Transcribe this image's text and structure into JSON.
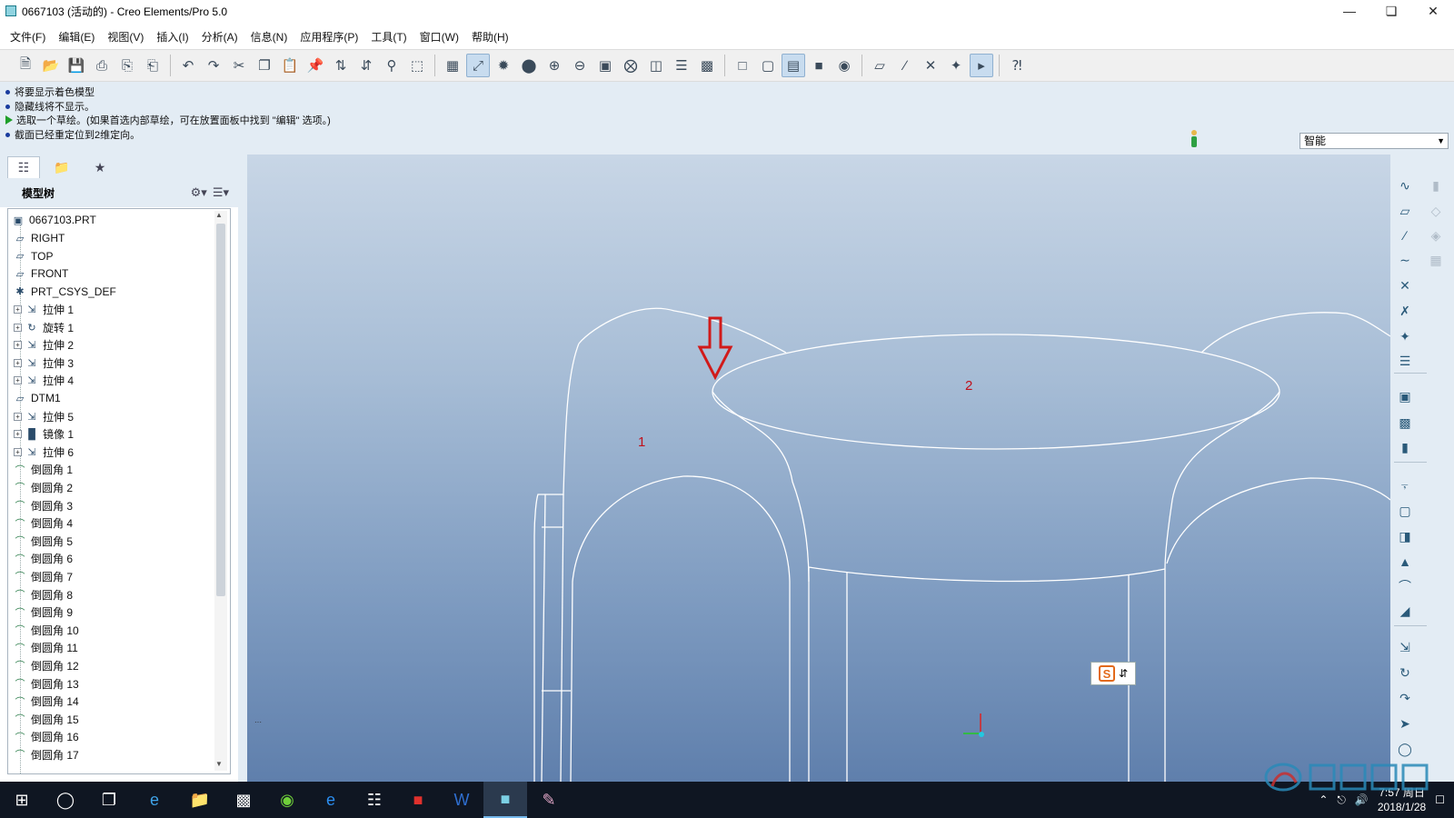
{
  "window": {
    "title": "0667103 (活动的) - Creo Elements/Pro 5.0",
    "controls": [
      "minimize-icon",
      "restore-icon",
      "close-icon"
    ]
  },
  "menubar": {
    "items": [
      "文件(F)",
      "编辑(E)",
      "视图(V)",
      "插入(I)",
      "分析(A)",
      "信息(N)",
      "应用程序(P)",
      "工具(T)",
      "窗口(W)",
      "帮助(H)"
    ]
  },
  "toolbar": {
    "icons": [
      "new-file-icon",
      "open-folder-icon",
      "save-icon",
      "print-icon",
      "print-preview-icon",
      "print-quick-icon",
      "undo-icon",
      "redo-icon",
      "cut-icon",
      "copy-icon",
      "paste-icon",
      "paste-special-icon",
      "regenerate-icon",
      "regen-manager-icon",
      "find-icon",
      "select-box-icon",
      "datum-display-icon",
      "axis-display-icon",
      "point-display-icon",
      "shading-icon",
      "zoom-in-icon",
      "zoom-out-icon",
      "refit-icon",
      "orient-icon",
      "saved-views-icon",
      "layers-icon",
      "view-manager-icon",
      "wireframe-icon",
      "hidden-line-icon",
      "no-hidden-icon",
      "shaded-icon",
      "enhanced-realism-icon",
      "datum-plane-display-icon",
      "datum-axis-display-icon",
      "point-display-toggle-icon",
      "csys-display-icon",
      "annotation-display-icon",
      "context-help-icon"
    ]
  },
  "messages": [
    {
      "type": "info",
      "text": "将要显示着色模型"
    },
    {
      "type": "info",
      "text": "隐藏线将不显示。"
    },
    {
      "type": "prompt",
      "text": "选取一个草绘。(如果首选内部草绘，可在放置面板中找到 \"编辑\" 选项。)"
    },
    {
      "type": "info",
      "text": "截面已经重定位到2维定向。"
    }
  ],
  "filter": {
    "value": "智能"
  },
  "navigator": {
    "tabs": [
      "model-tree-tab-icon",
      "folder-browser-tab-icon",
      "favorites-tab-icon"
    ],
    "header": "模型树"
  },
  "tree": {
    "root": "0667103.PRT",
    "items": [
      {
        "label": "RIGHT",
        "icon": "datum-plane-icon",
        "expandable": false
      },
      {
        "label": "TOP",
        "icon": "datum-plane-icon",
        "expandable": false
      },
      {
        "label": "FRONT",
        "icon": "datum-plane-icon",
        "expandable": false
      },
      {
        "label": "PRT_CSYS_DEF",
        "icon": "csys-icon",
        "expandable": false
      },
      {
        "label": "拉伸 1",
        "icon": "extrude-icon",
        "expandable": true
      },
      {
        "label": "旋转 1",
        "icon": "revolve-icon",
        "expandable": true
      },
      {
        "label": "拉伸 2",
        "icon": "extrude-icon",
        "expandable": true
      },
      {
        "label": "拉伸 3",
        "icon": "extrude-icon",
        "expandable": true
      },
      {
        "label": "拉伸 4",
        "icon": "extrude-icon",
        "expandable": true
      },
      {
        "label": "DTM1",
        "icon": "datum-plane-icon",
        "expandable": false
      },
      {
        "label": "拉伸 5",
        "icon": "extrude-icon",
        "expandable": true
      },
      {
        "label": "镜像 1",
        "icon": "mirror-icon",
        "expandable": true
      },
      {
        "label": "拉伸 6",
        "icon": "extrude-icon",
        "expandable": true
      },
      {
        "label": "倒圆角 1",
        "icon": "round-icon",
        "expandable": false
      },
      {
        "label": "倒圆角 2",
        "icon": "round-icon",
        "expandable": false
      },
      {
        "label": "倒圆角 3",
        "icon": "round-icon",
        "expandable": false
      },
      {
        "label": "倒圆角 4",
        "icon": "round-icon",
        "expandable": false
      },
      {
        "label": "倒圆角 5",
        "icon": "round-icon",
        "expandable": false
      },
      {
        "label": "倒圆角 6",
        "icon": "round-icon",
        "expandable": false
      },
      {
        "label": "倒圆角 7",
        "icon": "round-icon",
        "expandable": false
      },
      {
        "label": "倒圆角 8",
        "icon": "round-icon",
        "expandable": false
      },
      {
        "label": "倒圆角 9",
        "icon": "round-icon",
        "expandable": false
      },
      {
        "label": "倒圆角 10",
        "icon": "round-icon",
        "expandable": false
      },
      {
        "label": "倒圆角 11",
        "icon": "round-icon",
        "expandable": false
      },
      {
        "label": "倒圆角 12",
        "icon": "round-icon",
        "expandable": false
      },
      {
        "label": "倒圆角 13",
        "icon": "round-icon",
        "expandable": false
      },
      {
        "label": "倒圆角 14",
        "icon": "round-icon",
        "expandable": false
      },
      {
        "label": "倒圆角 15",
        "icon": "round-icon",
        "expandable": false
      },
      {
        "label": "倒圆角 16",
        "icon": "round-icon",
        "expandable": false
      },
      {
        "label": "倒圆角 17",
        "icon": "round-icon",
        "expandable": false
      }
    ]
  },
  "viewport": {
    "labels": {
      "surface1": "1",
      "surface2": "2"
    },
    "annotation_color": "#c0101a",
    "sketch_line_color": "#ffffff"
  },
  "taskbar": {
    "apps": [
      "windows-start-icon",
      "cortana-search-icon",
      "task-view-icon",
      "internet-explorer-icon",
      "file-explorer-icon",
      "app-window-icon",
      "browser-green-icon",
      "edge-icon",
      "calculator-icon",
      "youdao-icon",
      "word-icon",
      "creo-icon",
      "paint-icon"
    ],
    "time": "7:57 周日",
    "date": "2018/1/28"
  },
  "colors": {
    "message_bg": "#e3ecf4",
    "viewport_top": "#c8d6e6",
    "viewport_bottom": "#5f7fac",
    "taskbar": "#0f1622"
  }
}
